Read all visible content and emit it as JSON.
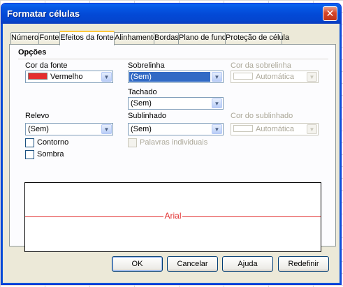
{
  "window": {
    "title": "Formatar células",
    "close_label": "✕"
  },
  "tabs": [
    {
      "label": "Números"
    },
    {
      "label": "Fonte"
    },
    {
      "label": "Efeitos da fonte"
    },
    {
      "label": "Alinhamento"
    },
    {
      "label": "Bordas"
    },
    {
      "label": "Plano de fundo"
    },
    {
      "label": "Proteção de célula"
    }
  ],
  "active_tab": "Efeitos da fonte",
  "options": {
    "title": "Opções",
    "font_color": {
      "label": "Cor da fonte",
      "value": "Vermelho",
      "swatch_color": "#e52d2d"
    },
    "overline": {
      "label": "Sobrelinha",
      "value": "(Sem)"
    },
    "overline_color": {
      "label": "Cor da sobrelinha",
      "value": "Automática"
    },
    "strikethrough": {
      "label": "Tachado",
      "value": "(Sem)"
    },
    "relief": {
      "label": "Relevo",
      "value": "(Sem)"
    },
    "underline": {
      "label": "Sublinhado",
      "value": "(Sem)"
    },
    "underline_color": {
      "label": "Cor do sublinhado",
      "value": "Automática"
    },
    "outline": {
      "label": "Contorno",
      "checked": false
    },
    "shadow": {
      "label": "Sombra",
      "checked": false
    },
    "individual_words": {
      "label": "Palavras individuais",
      "checked": false
    }
  },
  "preview": {
    "text": "Arial",
    "color": "#e23030"
  },
  "buttons": {
    "ok": "OK",
    "cancel": "Cancelar",
    "help": "Ajuda",
    "reset": "Redefinir"
  }
}
